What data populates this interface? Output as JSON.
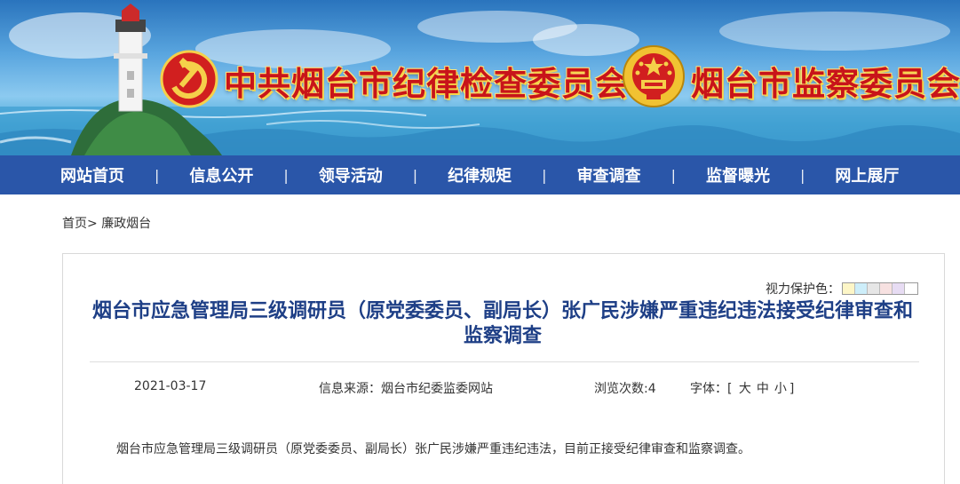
{
  "banner": {
    "left_title": "中共烟台市纪律检查委员会",
    "right_title": "烟台市监察委员会",
    "left_emblem_icon": "party-emblem-icon",
    "right_emblem_icon": "national-emblem-icon"
  },
  "nav": {
    "items": [
      "网站首页",
      "信息公开",
      "领导活动",
      "纪律规矩",
      "审查调查",
      "监督曝光",
      "网上展厅"
    ],
    "separator": "|"
  },
  "breadcrumb": {
    "home": "首页",
    "arrow": ">",
    "current": "廉政烟台"
  },
  "eye_care": {
    "label": "视力保护色：",
    "colors": [
      "#fdf6c7",
      "#cdeefa",
      "#e6e6e6",
      "#f7e1e1",
      "#e7dcf3",
      "#ffffff"
    ]
  },
  "article": {
    "title": "烟台市应急管理局三级调研员（原党委委员、副局长）张广民涉嫌严重违纪违法接受纪律审查和监察调查",
    "date": "2021-03-17",
    "source": "信息来源：烟台市纪委监委网站",
    "views_label": "浏览次数:",
    "views": "4",
    "font_label": "字体：[",
    "font_large": "大",
    "font_medium": "中",
    "font_small": "小",
    "font_close": "]",
    "body": "烟台市应急管理局三级调研员（原党委委员、副局长）张广民涉嫌严重违纪违法，目前正接受纪律审查和监察调查。"
  },
  "colors": {
    "nav_bg": "#2a56a9",
    "title_color": "#1e3f86",
    "banner_title": "#c8141a"
  }
}
